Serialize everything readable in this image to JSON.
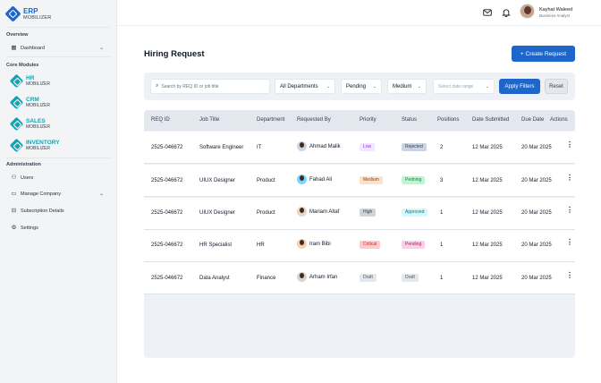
{
  "brand": {
    "name": "ERP",
    "sub": "MOBILIZER"
  },
  "sidebar": {
    "overview_label": "Overview",
    "dashboard": "Dashboard",
    "core_label": "Core Modules",
    "modules": [
      {
        "name": "HR",
        "sub": "MOBILIZER"
      },
      {
        "name": "CRM",
        "sub": "MOBILIZER"
      },
      {
        "name": "SALES",
        "sub": "MOBILIZER"
      },
      {
        "name": "INVENTORY",
        "sub": "MOBILIZER"
      }
    ],
    "admin_label": "Administration",
    "admin_items": [
      "Users",
      "Manage Company",
      "Subscription Details",
      "Settings"
    ]
  },
  "user": {
    "name": "Kayhat Waleed",
    "role": "Business Analyst"
  },
  "page": {
    "title": "Hiring Request",
    "create_label": "+ Create Request"
  },
  "filters": {
    "search_placeholder": "Search by REQ ID or job title",
    "department": "All Departments",
    "status": "Pending",
    "priority": "Medium",
    "date_placeholder": "Select date range",
    "apply_label": "Apply Filters",
    "reset_label": "Reset"
  },
  "table": {
    "headers": [
      "REQ ID",
      "Job Title",
      "Department",
      "Requested By",
      "Priority",
      "Status",
      "Positions",
      "Date Submitted",
      "Due Date",
      "Actions"
    ],
    "rows": [
      {
        "id": "2525-046672",
        "title": "Software Engineer",
        "dept": "IT",
        "by": "Ahmad Malik",
        "priority": "Low",
        "status": "Rejected",
        "positions": "2",
        "submitted": "12 Mar 2025",
        "due": "20 Mar 2025"
      },
      {
        "id": "2525-046672",
        "title": "UIUX Designer",
        "dept": "Product",
        "by": "Fahad Ali",
        "priority": "Medium",
        "status": "Pedning",
        "positions": "3",
        "submitted": "12 Mar 2025",
        "due": "20 Mar 2025"
      },
      {
        "id": "2525-046672",
        "title": "UIUX Designer",
        "dept": "Product",
        "by": "Mariam Altaf",
        "priority": "High",
        "status": "Approved",
        "positions": "1",
        "submitted": "12 Mar 2025",
        "due": "20 Mar 2025"
      },
      {
        "id": "2525-046672",
        "title": "HR Specialist",
        "dept": "HR",
        "by": "Iram Bibi",
        "priority": "Critical",
        "status": "Pending",
        "positions": "1",
        "submitted": "12 Mar 2025",
        "due": "20 Mar 2025"
      },
      {
        "id": "2525-046672",
        "title": "Data Analyst",
        "dept": "Finance",
        "by": "Arham Irfan",
        "priority": "Draft",
        "status": "Draft",
        "positions": "1",
        "submitted": "12 Mar 2025",
        "due": "20 Mar 2025"
      }
    ]
  },
  "colors": {
    "primary": "#1e66c9",
    "accent": "#0ea5b7"
  }
}
